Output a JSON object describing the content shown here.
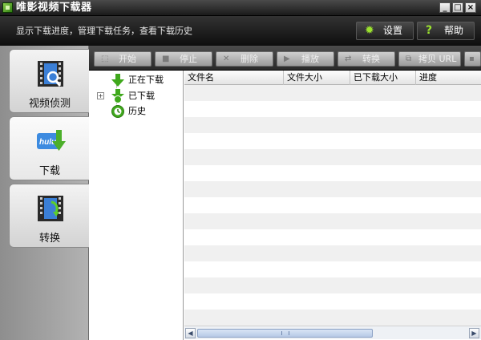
{
  "window": {
    "title": "唯影视频下载器",
    "controls": [
      "_",
      "□",
      "×"
    ]
  },
  "header": {
    "description": "显示下载进度，管理下载任务，查看下载历史",
    "settings_label": "设置",
    "settings_icon": "gear-icon",
    "help_label": "帮助",
    "help_icon": "question-icon"
  },
  "nav": {
    "items": [
      {
        "label": "视频侦测",
        "icon": "film-detect-icon"
      },
      {
        "label": "下载",
        "icon": "download-icon",
        "active": true
      },
      {
        "label": "转换",
        "icon": "convert-icon"
      }
    ]
  },
  "toolbar": {
    "start": "开始",
    "stop": "停止",
    "delete": "删除",
    "play": "播放",
    "convert": "转换",
    "copy_url": "拷贝 URL"
  },
  "tree": {
    "items": [
      {
        "label": "正在下载",
        "icon": "arrow-down-icon"
      },
      {
        "label": "已下载",
        "icon": "downloaded-icon"
      },
      {
        "label": "历史",
        "icon": "history-icon"
      }
    ]
  },
  "table": {
    "columns": [
      "文件名",
      "文件大小",
      "已下载大小",
      "进度"
    ],
    "rows": []
  },
  "colors": {
    "chrome_dark": "#1a1a1a",
    "accent_green": "#5cb82a",
    "row_alt": "#f0f0f0"
  }
}
